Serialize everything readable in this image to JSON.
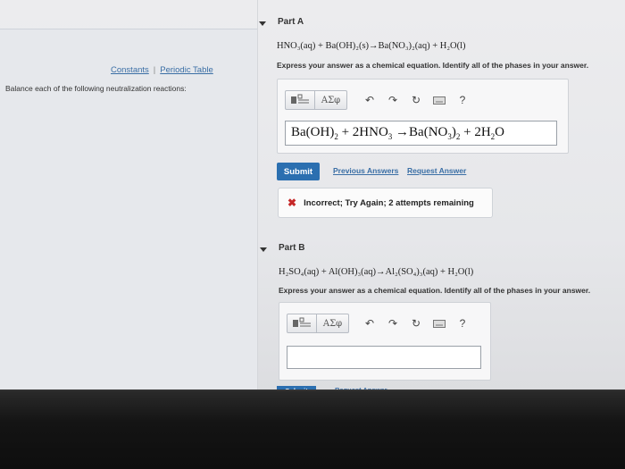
{
  "sidebar": {
    "constants_link": "Constants",
    "periodic_table_link": "Periodic Table",
    "instructions": "Balance each of the following neutralization reactions:"
  },
  "part_a": {
    "header": "Part A",
    "formula": "HNO₃(aq) + Ba(OH)₂(s)→Ba(NO₃)₂(aq) + H₂O(l)",
    "prompt": "Express your answer as a chemical equation. Identify all of the phases in your answer.",
    "toolbar": {
      "template_icon": "template-icon",
      "greek_label": "ΑΣφ",
      "help_label": "?"
    },
    "answer": "Ba(OH)₂ + 2HNO₃ →Ba(NO₃)₂ + 2H₂O",
    "submit_label": "Submit",
    "previous_answers_label": "Previous Answers",
    "request_answer_label": "Request Answer",
    "feedback": "Incorrect; Try Again; 2 attempts remaining"
  },
  "part_b": {
    "header": "Part B",
    "formula": "H₂SO₄(aq) + Al(OH)₃(aq)→Al₂(SO₄)₃(aq) + H₂O(l)",
    "prompt": "Express your answer as a chemical equation. Identify all of the phases in your answer.",
    "toolbar": {
      "greek_label": "ΑΣφ",
      "help_label": "?"
    },
    "answer": "",
    "submit_label": "Submit",
    "request_answer_label": "Request Answer"
  },
  "colors": {
    "accent": "#2b6fb0",
    "link": "#3a6ea5",
    "error": "#c62828"
  }
}
